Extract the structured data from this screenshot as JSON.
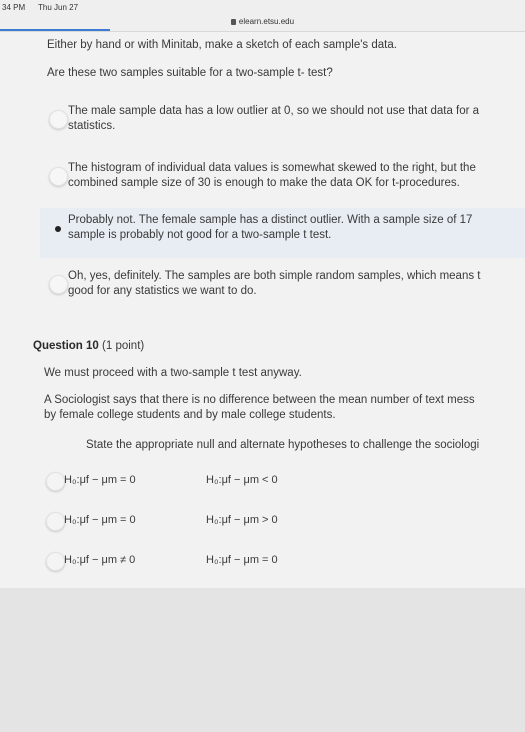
{
  "statusbar": {
    "time": "34 PM",
    "date": "Thu Jun 27"
  },
  "browser": {
    "url": "elearn.etsu.edu"
  },
  "q9": {
    "instruction": "Either by hand or with Minitab, make a sketch of each sample's data.",
    "question": "Are these two samples suitable for a two-sample t- test?",
    "options": [
      {
        "line1": "The male sample data has a low outlier at 0, so we should not use that data for a",
        "line2": "statistics.",
        "selected": false
      },
      {
        "line1": "The histogram of individual data values is somewhat skewed to the right, but the",
        "line2": "combined sample size of 30 is enough to make the data OK for t-procedures.",
        "selected": false
      },
      {
        "line1": "Probably not. The female sample has a distinct outlier. With a sample size of 17",
        "line2": "sample is probably not good for a two-sample t test.",
        "selected": true
      },
      {
        "line1": "Oh, yes, definitely. The samples are both simple random samples, which means t",
        "line2": "good for any statistics we want to do.",
        "selected": false
      }
    ]
  },
  "q10": {
    "title": "Question 10",
    "points": "(1 point)",
    "intro": "We must proceed with a two-sample t test anyway.",
    "claim_line1": "A Sociologist says that there is no difference between the mean number of text mess",
    "claim_line2": "by female college students and by male college students.",
    "prompt": "State the appropriate null and alternate hypotheses to challenge the sociologi",
    "options": [
      {
        "h0": "H₀:μf − μm = 0",
        "ha": "H₀:μf − μm < 0"
      },
      {
        "h0": "H₀:μf − μm = 0",
        "ha": "H₀:μf − μm > 0"
      },
      {
        "h0": "H₀:μf − μm ≠ 0",
        "ha": "H₀:μf − μm = 0"
      }
    ]
  }
}
